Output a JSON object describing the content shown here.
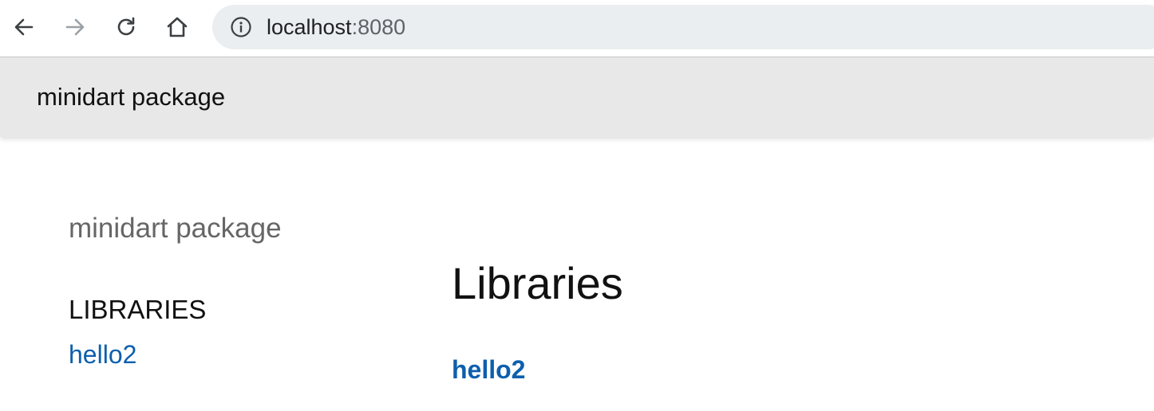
{
  "browser": {
    "back_icon": "arrow-left-icon",
    "forward_icon": "arrow-right-icon",
    "reload_icon": "reload-icon",
    "home_icon": "home-icon",
    "info_icon": "info-icon",
    "url_host": "localhost",
    "url_port": ":8080"
  },
  "header": {
    "title": "minidart package"
  },
  "sidebar": {
    "package_name": "minidart package",
    "libraries_heading": "LIBRARIES",
    "libraries": [
      {
        "label": "hello2"
      }
    ]
  },
  "main": {
    "title": "Libraries",
    "libraries": [
      {
        "label": "hello2"
      }
    ]
  },
  "colors": {
    "link": "#0d5fad",
    "header_bg": "#e8e8e8",
    "omnibox_bg": "#ebeef0"
  }
}
